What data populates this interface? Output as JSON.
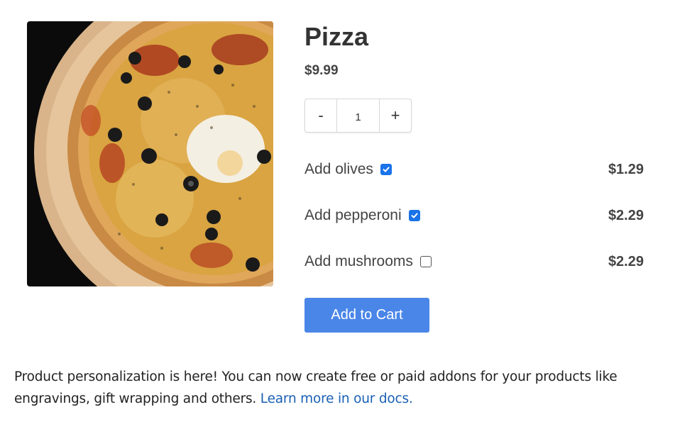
{
  "product": {
    "title": "Pizza",
    "price": "$9.99",
    "image_alt": "pizza-photo"
  },
  "quantity": {
    "decrement_label": "-",
    "value": "1",
    "increment_label": "+"
  },
  "addons": [
    {
      "label": "Add olives",
      "checked": true,
      "price": "$1.29"
    },
    {
      "label": "Add pepperoni",
      "checked": true,
      "price": "$2.29"
    },
    {
      "label": "Add mushrooms",
      "checked": false,
      "price": "$2.29"
    }
  ],
  "cart": {
    "button_label": "Add to Cart"
  },
  "note": {
    "text": "Product personalization is here! You can now create free or paid addons for your products like engravings, gift wrapping and others.",
    "link_text": "Learn more in our docs."
  },
  "colors": {
    "accent": "#4a86e8",
    "checkbox": "#1a73e8",
    "link": "#1a5fb4"
  }
}
